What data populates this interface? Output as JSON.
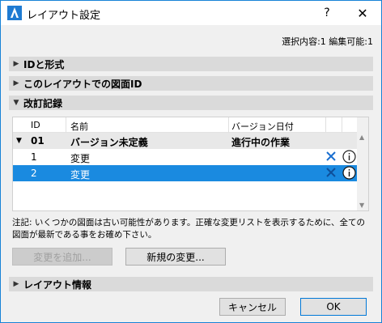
{
  "window": {
    "title": "レイアウト設定",
    "help": "?",
    "close": "✕"
  },
  "selection_info": "選択内容:1 編集可能:1",
  "sections": {
    "id_format": "IDと形式",
    "layout_drawing_id": "このレイアウトでの図面ID",
    "revision_history": "改訂記録",
    "layout_info": "レイアウト情報"
  },
  "table": {
    "headers": {
      "id": "ID",
      "name": "名前",
      "version_date": "バージョン日付"
    },
    "group": {
      "id": "01",
      "name": "バージョン未定義",
      "date": "進行中の作業"
    },
    "rows": [
      {
        "id": "1",
        "name": "変更"
      },
      {
        "id": "2",
        "name": "変更"
      }
    ]
  },
  "note": "注記: いくつかの図面は古い可能性があります。正確な変更リストを表示するために、全ての図面が最新である事をお確め下さい。",
  "buttons": {
    "add_change": "変更を追加...",
    "new_change": "新規の変更...",
    "cancel": "キャンセル",
    "ok": "OK"
  },
  "colors": {
    "accent": "#1a8ae0",
    "x_icon": "#1a6fd0"
  }
}
